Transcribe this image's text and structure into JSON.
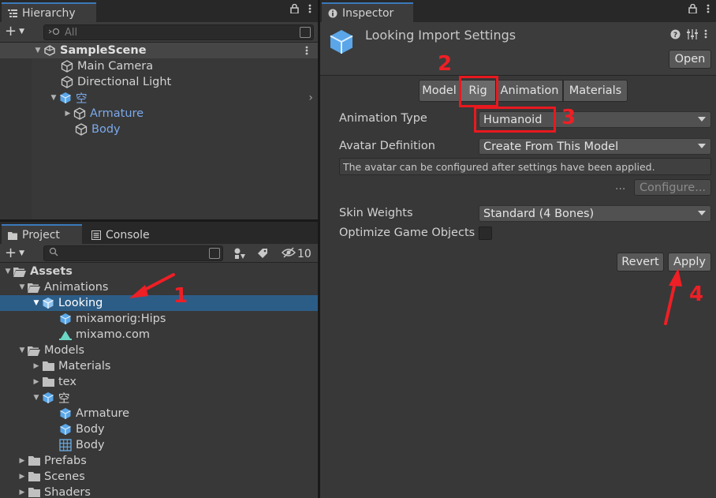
{
  "hierarchy": {
    "tab": "Hierarchy",
    "search_placeholder": "All",
    "scene": "SampleScene",
    "items": [
      "Main Camera",
      "Directional Light",
      "空",
      "Armature",
      "Body"
    ]
  },
  "project": {
    "tabs": [
      "Project",
      "Console"
    ],
    "hidden_count": "10",
    "tree": {
      "assets": "Assets",
      "animations": "Animations",
      "looking": "Looking",
      "hips": "mixamorig:Hips",
      "mixamo": "mixamo.com",
      "models": "Models",
      "materials": "Materials",
      "tex": "tex",
      "kong": "空",
      "armature": "Armature",
      "body1": "Body",
      "body2": "Body",
      "prefabs": "Prefabs",
      "scenes": "Scenes",
      "shaders": "Shaders"
    }
  },
  "inspector": {
    "tab": "Inspector",
    "title": "Looking Import Settings",
    "open_label": "Open",
    "tabs": [
      "Model",
      "Rig",
      "Animation",
      "Materials"
    ],
    "animation_type_label": "Animation Type",
    "animation_type_value": "Humanoid",
    "avatar_definition_label": "Avatar Definition",
    "avatar_definition_value": "Create From This Model",
    "help_text": "The avatar can be configured after settings have been applied.",
    "ellipsis": "...",
    "configure_label": "Configure...",
    "skin_weights_label": "Skin Weights",
    "skin_weights_value": "Standard (4 Bones)",
    "optimize_label": "Optimize Game Objects",
    "revert_label": "Revert",
    "apply_label": "Apply"
  },
  "annotations": [
    "1",
    "2",
    "3",
    "4"
  ],
  "colors": {
    "selection": "#2c5d87",
    "highlight_red": "#e8191f",
    "accent_tab": "#3a79bb"
  }
}
